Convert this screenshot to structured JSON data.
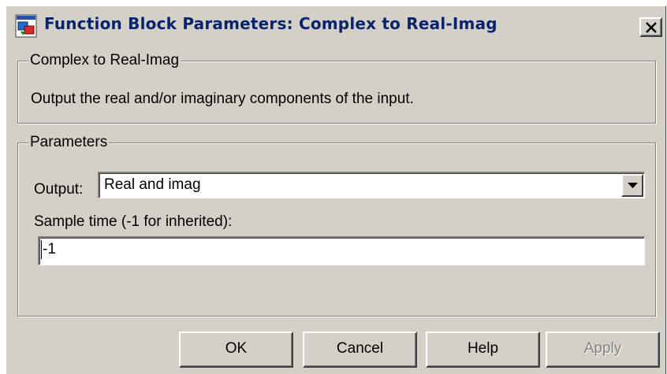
{
  "window": {
    "title": "Function Block Parameters: Complex to Real-Imag",
    "close_glyph": "×"
  },
  "description_group": {
    "legend": "Complex to Real-Imag",
    "text": "Output the real and/or imaginary components of the input."
  },
  "parameters_group": {
    "legend": "Parameters",
    "output_label": "Output:",
    "output_value": "Real and imag",
    "sample_time_label": "Sample time (-1 for inherited):",
    "sample_time_value": "-1"
  },
  "buttons": {
    "ok": "OK",
    "cancel": "Cancel",
    "help": "Help",
    "apply": "Apply"
  },
  "colors": {
    "dialog_face": "#d4d0c8",
    "title_text": "#0a246a",
    "disabled_text": "#808080"
  },
  "icons": [
    "simulink-block-icon",
    "close-icon",
    "dropdown-arrow-icon"
  ]
}
